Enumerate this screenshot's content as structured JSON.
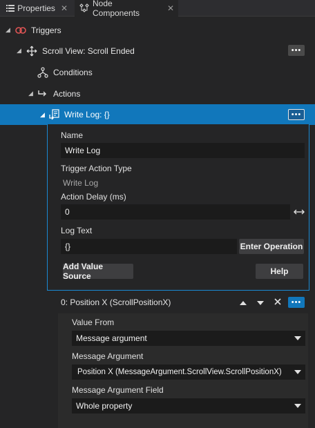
{
  "tabs": [
    {
      "label": "Properties",
      "icon": "list-icon",
      "close": "✕"
    },
    {
      "label": "Node Components",
      "icon": "node-components-icon",
      "close": "✕"
    }
  ],
  "tree": {
    "triggers": "Triggers",
    "scroll_view": "Scroll View: Scroll Ended",
    "conditions": "Conditions",
    "actions": "Actions",
    "write_log": "Write Log: {}",
    "more": "•••"
  },
  "action": {
    "name_label": "Name",
    "name_value": "Write Log",
    "type_label": "Trigger Action Type",
    "type_value": "Write Log",
    "delay_label": "Action Delay (ms)",
    "delay_value": "0",
    "log_label": "Log Text",
    "log_value": "{}",
    "enter_operation": "Enter Operation",
    "add_value_source": "Add Value Source",
    "help": "Help"
  },
  "value_source": {
    "title": "0: Position X (ScrollPositionX)",
    "value_from_label": "Value From",
    "value_from": "Message argument",
    "message_argument_label": "Message Argument",
    "message_argument": "Position X (MessageArgument.ScrollView.ScrollPositionX)",
    "field_label": "Message Argument Field",
    "field": "Whole property"
  },
  "colors": {
    "accent": "#1177bb",
    "background": "#252526",
    "input": "#1b1b1b"
  }
}
